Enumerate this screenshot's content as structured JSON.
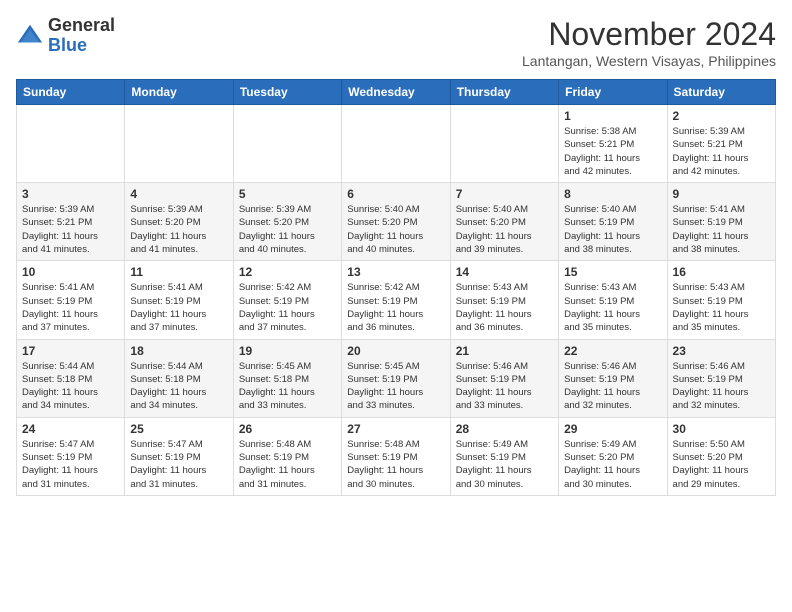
{
  "header": {
    "logo": {
      "line1": "General",
      "line2": "Blue"
    },
    "month_year": "November 2024",
    "location": "Lantangan, Western Visayas, Philippines"
  },
  "weekdays": [
    "Sunday",
    "Monday",
    "Tuesday",
    "Wednesday",
    "Thursday",
    "Friday",
    "Saturday"
  ],
  "weeks": [
    [
      {
        "day": "",
        "info": ""
      },
      {
        "day": "",
        "info": ""
      },
      {
        "day": "",
        "info": ""
      },
      {
        "day": "",
        "info": ""
      },
      {
        "day": "",
        "info": ""
      },
      {
        "day": "1",
        "info": "Sunrise: 5:38 AM\nSunset: 5:21 PM\nDaylight: 11 hours\nand 42 minutes."
      },
      {
        "day": "2",
        "info": "Sunrise: 5:39 AM\nSunset: 5:21 PM\nDaylight: 11 hours\nand 42 minutes."
      }
    ],
    [
      {
        "day": "3",
        "info": "Sunrise: 5:39 AM\nSunset: 5:21 PM\nDaylight: 11 hours\nand 41 minutes."
      },
      {
        "day": "4",
        "info": "Sunrise: 5:39 AM\nSunset: 5:20 PM\nDaylight: 11 hours\nand 41 minutes."
      },
      {
        "day": "5",
        "info": "Sunrise: 5:39 AM\nSunset: 5:20 PM\nDaylight: 11 hours\nand 40 minutes."
      },
      {
        "day": "6",
        "info": "Sunrise: 5:40 AM\nSunset: 5:20 PM\nDaylight: 11 hours\nand 40 minutes."
      },
      {
        "day": "7",
        "info": "Sunrise: 5:40 AM\nSunset: 5:20 PM\nDaylight: 11 hours\nand 39 minutes."
      },
      {
        "day": "8",
        "info": "Sunrise: 5:40 AM\nSunset: 5:19 PM\nDaylight: 11 hours\nand 38 minutes."
      },
      {
        "day": "9",
        "info": "Sunrise: 5:41 AM\nSunset: 5:19 PM\nDaylight: 11 hours\nand 38 minutes."
      }
    ],
    [
      {
        "day": "10",
        "info": "Sunrise: 5:41 AM\nSunset: 5:19 PM\nDaylight: 11 hours\nand 37 minutes."
      },
      {
        "day": "11",
        "info": "Sunrise: 5:41 AM\nSunset: 5:19 PM\nDaylight: 11 hours\nand 37 minutes."
      },
      {
        "day": "12",
        "info": "Sunrise: 5:42 AM\nSunset: 5:19 PM\nDaylight: 11 hours\nand 37 minutes."
      },
      {
        "day": "13",
        "info": "Sunrise: 5:42 AM\nSunset: 5:19 PM\nDaylight: 11 hours\nand 36 minutes."
      },
      {
        "day": "14",
        "info": "Sunrise: 5:43 AM\nSunset: 5:19 PM\nDaylight: 11 hours\nand 36 minutes."
      },
      {
        "day": "15",
        "info": "Sunrise: 5:43 AM\nSunset: 5:19 PM\nDaylight: 11 hours\nand 35 minutes."
      },
      {
        "day": "16",
        "info": "Sunrise: 5:43 AM\nSunset: 5:19 PM\nDaylight: 11 hours\nand 35 minutes."
      }
    ],
    [
      {
        "day": "17",
        "info": "Sunrise: 5:44 AM\nSunset: 5:18 PM\nDaylight: 11 hours\nand 34 minutes."
      },
      {
        "day": "18",
        "info": "Sunrise: 5:44 AM\nSunset: 5:18 PM\nDaylight: 11 hours\nand 34 minutes."
      },
      {
        "day": "19",
        "info": "Sunrise: 5:45 AM\nSunset: 5:18 PM\nDaylight: 11 hours\nand 33 minutes."
      },
      {
        "day": "20",
        "info": "Sunrise: 5:45 AM\nSunset: 5:19 PM\nDaylight: 11 hours\nand 33 minutes."
      },
      {
        "day": "21",
        "info": "Sunrise: 5:46 AM\nSunset: 5:19 PM\nDaylight: 11 hours\nand 33 minutes."
      },
      {
        "day": "22",
        "info": "Sunrise: 5:46 AM\nSunset: 5:19 PM\nDaylight: 11 hours\nand 32 minutes."
      },
      {
        "day": "23",
        "info": "Sunrise: 5:46 AM\nSunset: 5:19 PM\nDaylight: 11 hours\nand 32 minutes."
      }
    ],
    [
      {
        "day": "24",
        "info": "Sunrise: 5:47 AM\nSunset: 5:19 PM\nDaylight: 11 hours\nand 31 minutes."
      },
      {
        "day": "25",
        "info": "Sunrise: 5:47 AM\nSunset: 5:19 PM\nDaylight: 11 hours\nand 31 minutes."
      },
      {
        "day": "26",
        "info": "Sunrise: 5:48 AM\nSunset: 5:19 PM\nDaylight: 11 hours\nand 31 minutes."
      },
      {
        "day": "27",
        "info": "Sunrise: 5:48 AM\nSunset: 5:19 PM\nDaylight: 11 hours\nand 30 minutes."
      },
      {
        "day": "28",
        "info": "Sunrise: 5:49 AM\nSunset: 5:19 PM\nDaylight: 11 hours\nand 30 minutes."
      },
      {
        "day": "29",
        "info": "Sunrise: 5:49 AM\nSunset: 5:20 PM\nDaylight: 11 hours\nand 30 minutes."
      },
      {
        "day": "30",
        "info": "Sunrise: 5:50 AM\nSunset: 5:20 PM\nDaylight: 11 hours\nand 29 minutes."
      }
    ]
  ]
}
